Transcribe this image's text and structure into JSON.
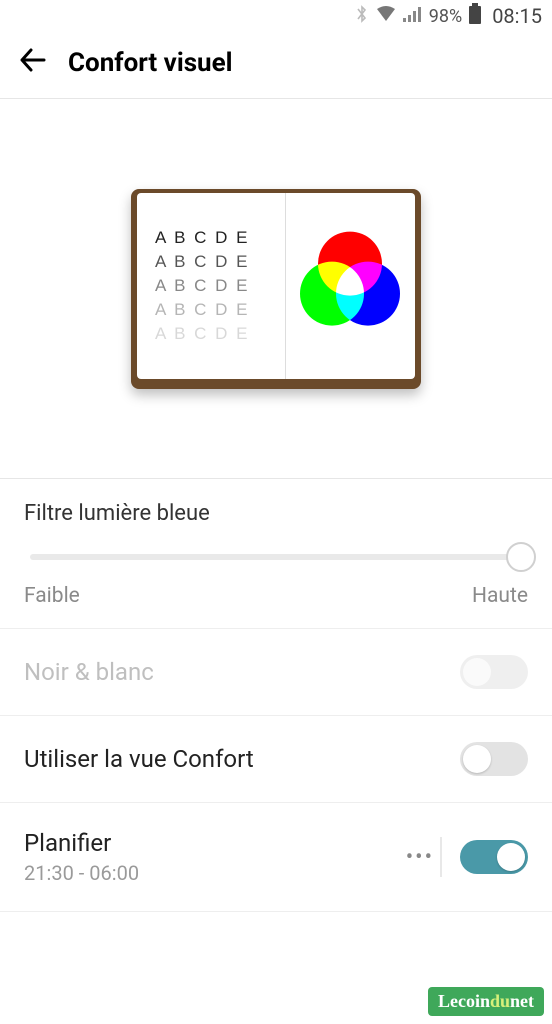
{
  "status": {
    "battery_percent": "98%",
    "time": "08:15"
  },
  "header": {
    "title": "Confort visuel"
  },
  "illustration": {
    "text_sample": "A B C D E"
  },
  "filter": {
    "label": "Filtre lumière bleue",
    "min_label": "Faible",
    "max_label": "Haute",
    "value": 100
  },
  "options": {
    "bw": {
      "label": "Noir & blanc",
      "enabled": false,
      "on": false
    },
    "comfort": {
      "label": "Utiliser la vue Confort",
      "enabled": true,
      "on": false
    },
    "schedule": {
      "label": "Planifier",
      "sublabel": "21:30 - 06:00",
      "enabled": true,
      "on": true
    }
  },
  "watermark": {
    "pre": "Lecoin",
    "mid": "du",
    "post": "net"
  }
}
